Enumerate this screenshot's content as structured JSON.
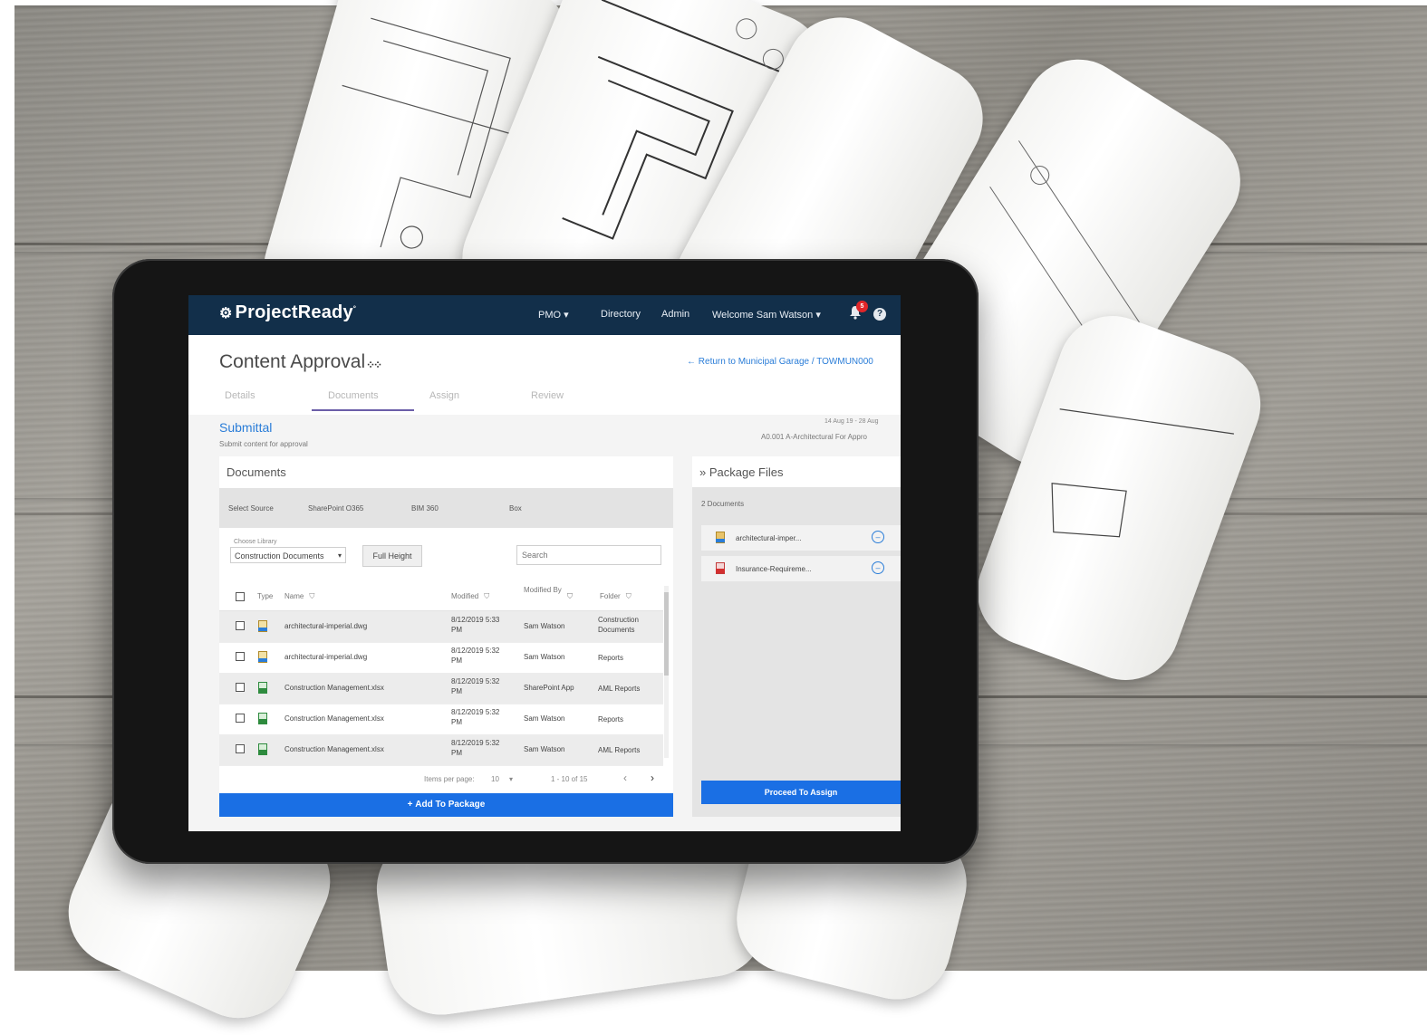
{
  "header": {
    "logo": "ProjectReady",
    "nav": {
      "pmo": "PMO",
      "directory": "Directory",
      "admin": "Admin",
      "welcome": "Welcome Sam Watson"
    },
    "notification_count": "5",
    "help": "?"
  },
  "page": {
    "title": "Content Approval",
    "return_link": "Return to Municipal Garage / TOWMUN000",
    "tabs": [
      "Details",
      "Documents",
      "Assign",
      "Review"
    ],
    "active_tab": "Documents",
    "section_title": "Submittal",
    "section_caption": "Submit content for approval",
    "meta_dates": "14 Aug 19 - 28 Aug",
    "meta_code": "A0.001  A-Architectural  For Appro"
  },
  "documents": {
    "title": "Documents",
    "source_label": "Select Source",
    "sources": [
      "SharePoint O365",
      "BIM 360",
      "Box"
    ],
    "library_label": "Choose Library",
    "library_value": "Construction Documents",
    "full_height": "Full Height",
    "search_placeholder": "Search",
    "columns": {
      "type": "Type",
      "name": "Name",
      "modified": "Modified",
      "modified_by": "Modified By",
      "folder": "Folder"
    },
    "rows": [
      {
        "name": "architectural-imperial.dwg",
        "modified": "8/12/2019 5:33 PM",
        "by": "Sam Watson",
        "folder": "Construction Documents",
        "icon": "dwg"
      },
      {
        "name": "architectural-imperial.dwg",
        "modified": "8/12/2019 5:32 PM",
        "by": "Sam Watson",
        "folder": "Reports",
        "icon": "dwg"
      },
      {
        "name": "Construction Management.xlsx",
        "modified": "8/12/2019 5:32 PM",
        "by": "SharePoint App",
        "folder": "AML Reports",
        "icon": "xlsx"
      },
      {
        "name": "Construction Management.xlsx",
        "modified": "8/12/2019 5:32 PM",
        "by": "Sam Watson",
        "folder": "Reports",
        "icon": "xlsx"
      },
      {
        "name": "Construction Management.xlsx",
        "modified": "8/12/2019 5:32 PM",
        "by": "Sam Watson",
        "folder": "AML Reports",
        "icon": "xlsx"
      }
    ],
    "items_per_page_label": "Items per page:",
    "items_per_page": "10",
    "range": "1 - 10 of 15",
    "add_button": "Add To Package"
  },
  "package": {
    "title": "Package Files",
    "count": "2 Documents",
    "items": [
      {
        "name": "architectural-imper...",
        "icon": "dwg"
      },
      {
        "name": "Insurance-Requireme...",
        "icon": "pdf"
      }
    ],
    "proceed_button": "Proceed To Assign"
  },
  "colors": {
    "topbar": "#122f4a",
    "accent": "#1a6fe4",
    "link": "#2a7dd8",
    "tab_underline": "#6b5ea8"
  }
}
